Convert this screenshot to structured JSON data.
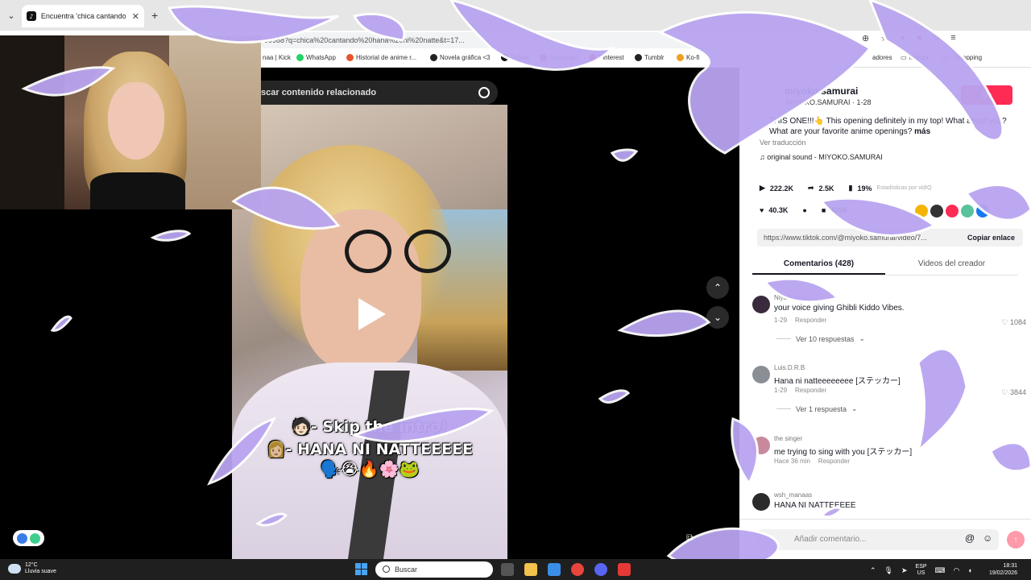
{
  "browser": {
    "tab_title": "Encuentra 'chica cantando hana",
    "url": "99988?q=chica%20cantando%20hana%20ni%20natte&t=17...",
    "bookmarks": [
      "naa | Kick",
      "WhatsApp",
      "Historial de anime r...",
      "Novela gráfica <3",
      "Twitter",
      "Instagram",
      "Pinterest",
      "Tumblr",
      "Ko-fi",
      "adores",
      "Manga",
      "~Shopping"
    ]
  },
  "video": {
    "search_placeholder": "scar contenido relacionado",
    "caption_line1": "🧑🏻- Skip the intro!",
    "caption_line2": "👩🏼- HANA NI NATTEEEEE",
    "caption_line3": "🗣️😭🔥🌸🐸"
  },
  "panel": {
    "author": "miyoko.samurai",
    "handle": "MIYOKO.SAMURAI · 1-28",
    "follow_label": "Se",
    "description": "THIS ONE!!!👆 This opening definitely in my top! What about you? What are your favorite anime openings?",
    "more_label": "más",
    "translation_label": "Ver traducción",
    "sound": "original sound - MIYOKO.SAMURAI",
    "plays": "222.2K",
    "shares": "2.5K",
    "percent": "19%",
    "stats_link": "Estadísticas por vidIQ",
    "likes": "40.3K",
    "saves": "4259",
    "link_url": "https://www.tiktok.com/@miyoko.samurai/video/7...",
    "copy_label": "Copiar enlace",
    "tab_comments": "Comentarios (428)",
    "tab_creator": "Videos del creador",
    "comments": [
      {
        "user": "Niya Koroko",
        "text": "your voice giving Ghibli Kiddo Vibes.",
        "date": "1-29",
        "reply": "Responder",
        "likes": "1084",
        "view_replies": "Ver 10 respuestas"
      },
      {
        "user": "Luis.D.R.B",
        "text": "Hana ni natteeeeeeee [ステッカー]",
        "date": "1-29",
        "reply": "Responder",
        "likes": "3844",
        "view_replies": "Ver 1 respuesta"
      },
      {
        "user": "the singer",
        "text": "me trying to sing with you [ステッカー]",
        "date": "Hace 36 min",
        "reply": "Responder",
        "likes": "",
        "view_replies": ""
      },
      {
        "user": "wsh_manaas",
        "text": "HANA NI NATTEEEEE",
        "date": "",
        "reply": "",
        "likes": "",
        "view_replies": ""
      }
    ],
    "comment_placeholder": "Añadir comentario..."
  },
  "taskbar": {
    "temp": "12°C",
    "weather": "Lluvia suave",
    "search_label": "Buscar",
    "lang": "ESP",
    "region": "US",
    "time": "18:31",
    "date": "19/02/2026"
  },
  "colors": {
    "accent": "#fe2c55",
    "overlay": "#b9a4f0"
  }
}
